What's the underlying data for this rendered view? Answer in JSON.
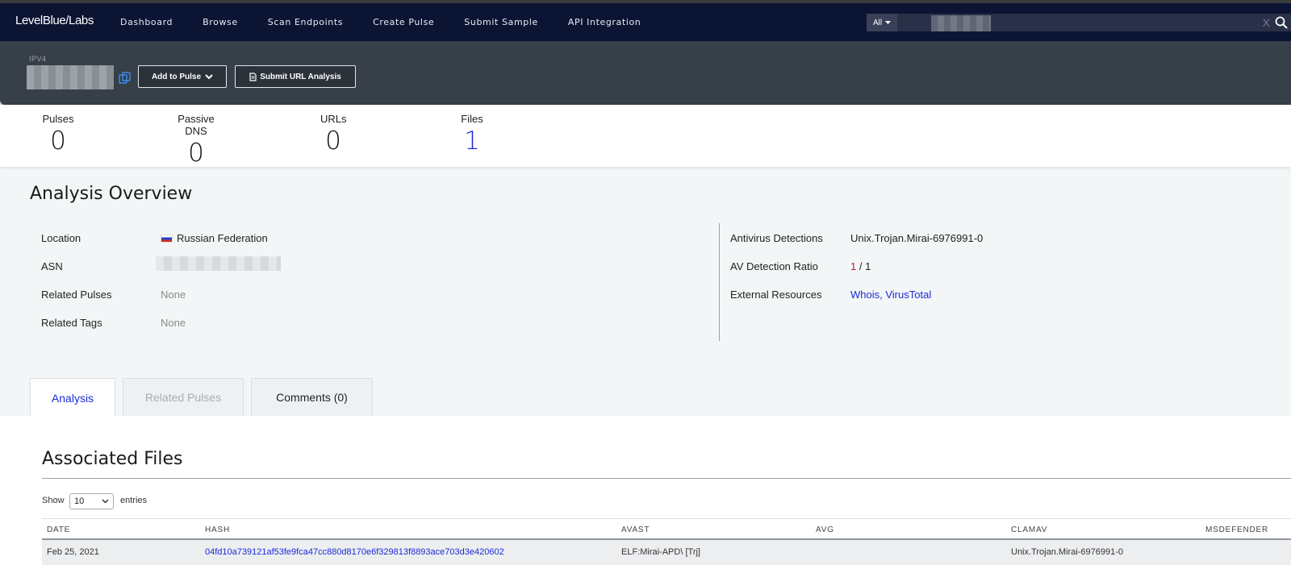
{
  "nav": {
    "logo": "LevelBlue/Labs",
    "links": [
      "Dashboard",
      "Browse",
      "Scan Endpoints",
      "Create Pulse",
      "Submit Sample",
      "API Integration"
    ],
    "search_scope": "All",
    "clear": "X"
  },
  "header": {
    "type_label": "IPV4",
    "add_to_pulse": "Add to Pulse",
    "submit_url": "Submit URL Analysis"
  },
  "stats": {
    "pulses_label": "Pulses",
    "pulses_value": "0",
    "dns_label": "Passive DNS",
    "dns_value": "0",
    "urls_label": "URLs",
    "urls_value": "0",
    "files_label": "Files",
    "files_value": "1"
  },
  "overview": {
    "title": "Analysis Overview",
    "location_label": "Location",
    "location_value": "Russian Federation",
    "asn_label": "ASN",
    "related_pulses_label": "Related Pulses",
    "related_pulses_value": "None",
    "related_tags_label": "Related Tags",
    "related_tags_value": "None",
    "av_detections_label": "Antivirus Detections",
    "av_detections_value": "Unix.Trojan.Mirai-6976991-0",
    "av_ratio_label": "AV Detection Ratio",
    "av_ratio_hits": "1",
    "av_ratio_total": " / 1",
    "external_label": "External Resources",
    "external_whois": "Whois",
    "external_sep": ", ",
    "external_vt": "VirusTotal"
  },
  "tabs": {
    "analysis": "Analysis",
    "related_pulses": "Related Pulses",
    "comments": "Comments (0)"
  },
  "files": {
    "title": "Associated Files",
    "show": "Show",
    "entries_value": "10",
    "entries": "entries",
    "columns": [
      "DATE",
      "HASH",
      "AVAST",
      "AVG",
      "CLAMAV",
      "MSDEFENDER"
    ],
    "rows": [
      {
        "date": "Feb 25, 2021",
        "hash": "04fd10a739121af53fe9fca47cc880d8170e6f329813f8893ace703d3e420602",
        "avast": "ELF:Mirai-APD\\ [Trj]",
        "avg": "",
        "clamav": "Unix.Trojan.Mirai-6976991-0",
        "msdefender": ""
      }
    ]
  },
  "colors": {
    "navbar": "#0c1433",
    "header_panel": "#373f49",
    "link": "#1a2bd4",
    "alert": "#c8102e"
  }
}
